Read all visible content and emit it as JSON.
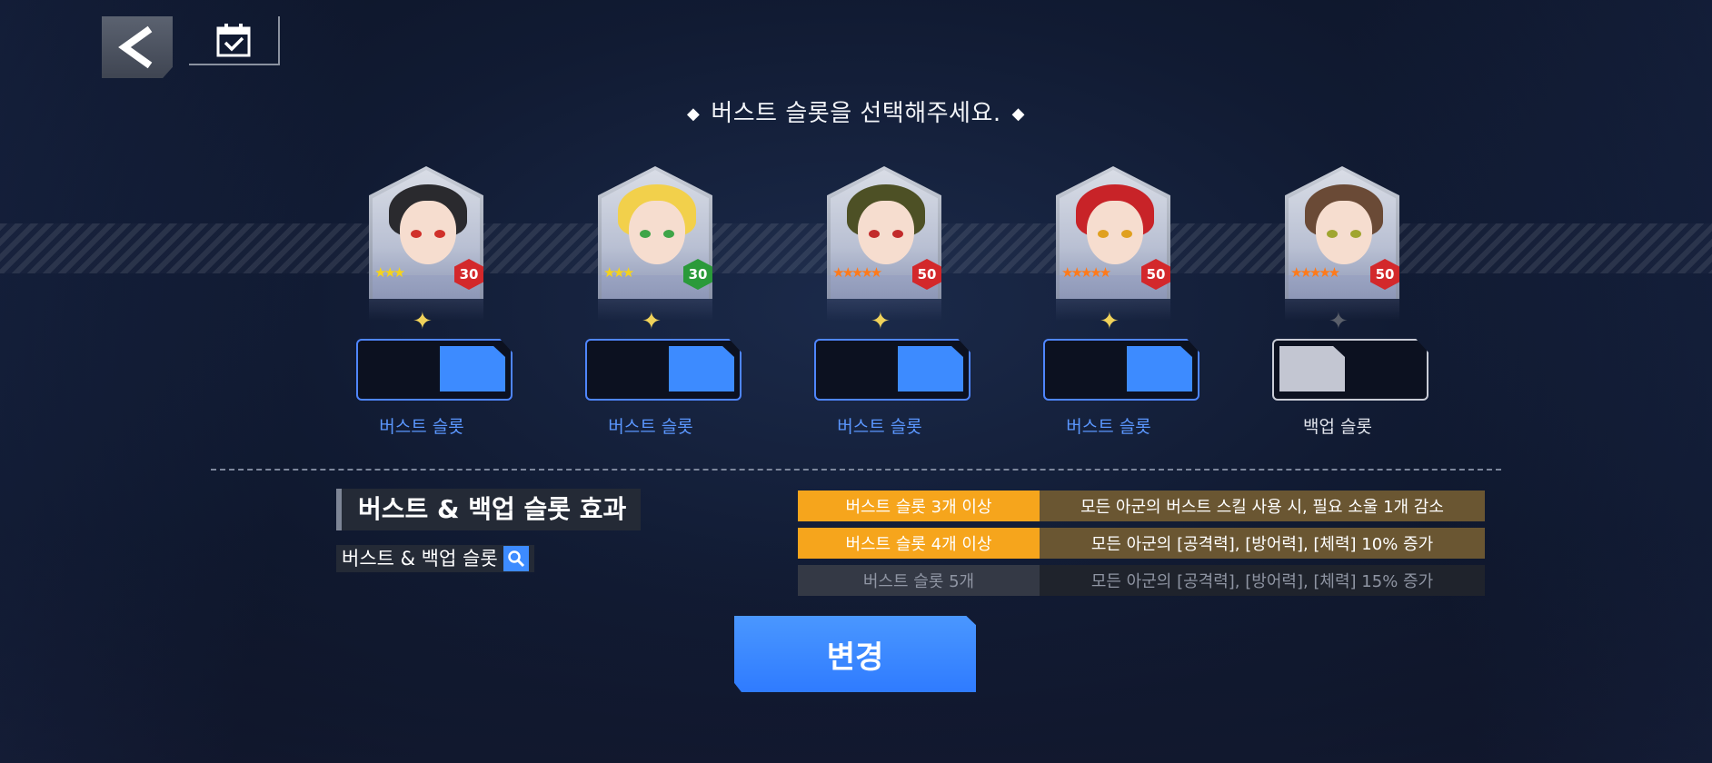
{
  "header": {
    "title": "버스트 슬롯을 선택해주세요.",
    "back_icon": "chevron-left-icon",
    "calendar_icon": "calendar-check-icon"
  },
  "slots": [
    {
      "level": "30",
      "stars": 3,
      "star_color": "#f5d31b",
      "level_color": "#d3282b",
      "sparkle_active": true,
      "type": "burst",
      "label": "버스트 슬롯",
      "hair": "#2a2a2e",
      "eye": "#d0302a"
    },
    {
      "level": "30",
      "stars": 3,
      "star_color": "#f5d31b",
      "level_color": "#2a9a3a",
      "sparkle_active": true,
      "type": "burst",
      "label": "버스트 슬롯",
      "hair": "#f2d04b",
      "eye": "#3fa548"
    },
    {
      "level": "50",
      "stars": 5,
      "star_color": "#ff7a1a",
      "level_color": "#d3282b",
      "sparkle_active": true,
      "type": "burst",
      "label": "버스트 슬롯",
      "hair": "#4d5025",
      "eye": "#c22b2b"
    },
    {
      "level": "50",
      "stars": 5,
      "star_color": "#ff7a1a",
      "level_color": "#d3282b",
      "sparkle_active": true,
      "type": "burst",
      "label": "버스트 슬롯",
      "hair": "#c82328",
      "eye": "#e0a020"
    },
    {
      "level": "50",
      "stars": 5,
      "star_color": "#ff7a1a",
      "level_color": "#d3282b",
      "sparkle_active": false,
      "type": "backup",
      "label": "백업 슬롯",
      "hair": "#6a4a36",
      "eye": "#a0a530"
    }
  ],
  "effects": {
    "title": "버스트 & 백업 슬롯 효과",
    "subtitle": "버스트 & 백업 슬롯",
    "subtitle_icon": "search-icon",
    "rows": [
      {
        "condition": "버스트 슬롯 3개 이상",
        "effect": "모든 아군의 버스트 스킬 사용 시, 필요 소울 1개 감소",
        "active": true
      },
      {
        "condition": "버스트 슬롯 4개 이상",
        "effect": "모든 아군의 [공격력], [방어력], [체력] 10% 증가",
        "active": true
      },
      {
        "condition": "버스트 슬롯 5개",
        "effect": "모든 아군의 [공격력], [방어력], [체력] 15% 증가",
        "active": false
      }
    ]
  },
  "actions": {
    "change_label": "변경"
  },
  "colors": {
    "accent": "#3d8bff",
    "active_condition": "#f6a51c",
    "active_effect": "#6a5632"
  }
}
